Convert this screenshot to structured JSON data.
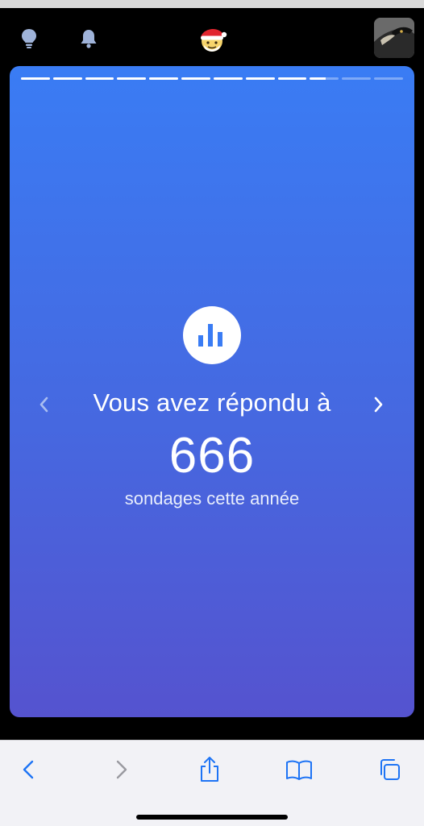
{
  "colors": {
    "accent": "#1e74f5",
    "card_top": "#3a7cf4",
    "card_bottom": "#5553cf",
    "toolbar_bg": "#f2f2f6"
  },
  "header": {
    "icons": [
      "lightbulb-icon",
      "bell-icon",
      "santa-emoji",
      "profile-avatar"
    ],
    "emoji": "🎅"
  },
  "story": {
    "segments_total": 12,
    "segments_completed": 9,
    "current_segment_progress": 0.55,
    "icon": "bar-chart-icon",
    "headline": "Vous avez répondu à",
    "count": "666",
    "subtext": "sondages cette année"
  },
  "browser_toolbar": {
    "icons": [
      "back-icon",
      "forward-icon",
      "share-icon",
      "bookmarks-icon",
      "tabs-icon"
    ]
  }
}
